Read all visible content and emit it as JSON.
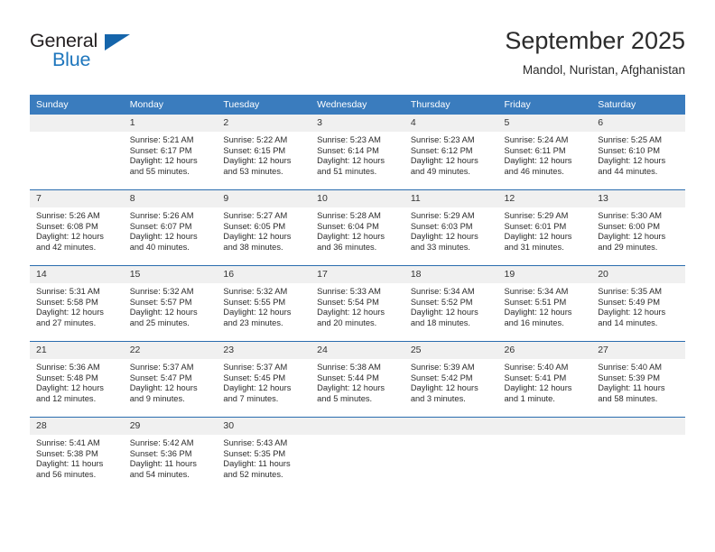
{
  "brand": {
    "name_part1": "General",
    "name_part2": "Blue",
    "accent_color": "#1565ab",
    "triangle_icon": "triangle-icon"
  },
  "header": {
    "title": "September 2025",
    "subtitle": "Mandol, Nuristan, Afghanistan"
  },
  "calendar": {
    "header_bg": "#3a7cbe",
    "daynum_bg": "#f0f0f0",
    "separator_color": "#2a6cae",
    "weekday_headers": [
      "Sunday",
      "Monday",
      "Tuesday",
      "Wednesday",
      "Thursday",
      "Friday",
      "Saturday"
    ],
    "weeks": [
      [
        {
          "day": "",
          "sunrise": "",
          "sunset": "",
          "daylight1": "",
          "daylight2": "",
          "blank": true
        },
        {
          "day": "1",
          "sunrise": "Sunrise: 5:21 AM",
          "sunset": "Sunset: 6:17 PM",
          "daylight1": "Daylight: 12 hours",
          "daylight2": "and 55 minutes."
        },
        {
          "day": "2",
          "sunrise": "Sunrise: 5:22 AM",
          "sunset": "Sunset: 6:15 PM",
          "daylight1": "Daylight: 12 hours",
          "daylight2": "and 53 minutes."
        },
        {
          "day": "3",
          "sunrise": "Sunrise: 5:23 AM",
          "sunset": "Sunset: 6:14 PM",
          "daylight1": "Daylight: 12 hours",
          "daylight2": "and 51 minutes."
        },
        {
          "day": "4",
          "sunrise": "Sunrise: 5:23 AM",
          "sunset": "Sunset: 6:12 PM",
          "daylight1": "Daylight: 12 hours",
          "daylight2": "and 49 minutes."
        },
        {
          "day": "5",
          "sunrise": "Sunrise: 5:24 AM",
          "sunset": "Sunset: 6:11 PM",
          "daylight1": "Daylight: 12 hours",
          "daylight2": "and 46 minutes."
        },
        {
          "day": "6",
          "sunrise": "Sunrise: 5:25 AM",
          "sunset": "Sunset: 6:10 PM",
          "daylight1": "Daylight: 12 hours",
          "daylight2": "and 44 minutes."
        }
      ],
      [
        {
          "day": "7",
          "sunrise": "Sunrise: 5:26 AM",
          "sunset": "Sunset: 6:08 PM",
          "daylight1": "Daylight: 12 hours",
          "daylight2": "and 42 minutes."
        },
        {
          "day": "8",
          "sunrise": "Sunrise: 5:26 AM",
          "sunset": "Sunset: 6:07 PM",
          "daylight1": "Daylight: 12 hours",
          "daylight2": "and 40 minutes."
        },
        {
          "day": "9",
          "sunrise": "Sunrise: 5:27 AM",
          "sunset": "Sunset: 6:05 PM",
          "daylight1": "Daylight: 12 hours",
          "daylight2": "and 38 minutes."
        },
        {
          "day": "10",
          "sunrise": "Sunrise: 5:28 AM",
          "sunset": "Sunset: 6:04 PM",
          "daylight1": "Daylight: 12 hours",
          "daylight2": "and 36 minutes."
        },
        {
          "day": "11",
          "sunrise": "Sunrise: 5:29 AM",
          "sunset": "Sunset: 6:03 PM",
          "daylight1": "Daylight: 12 hours",
          "daylight2": "and 33 minutes."
        },
        {
          "day": "12",
          "sunrise": "Sunrise: 5:29 AM",
          "sunset": "Sunset: 6:01 PM",
          "daylight1": "Daylight: 12 hours",
          "daylight2": "and 31 minutes."
        },
        {
          "day": "13",
          "sunrise": "Sunrise: 5:30 AM",
          "sunset": "Sunset: 6:00 PM",
          "daylight1": "Daylight: 12 hours",
          "daylight2": "and 29 minutes."
        }
      ],
      [
        {
          "day": "14",
          "sunrise": "Sunrise: 5:31 AM",
          "sunset": "Sunset: 5:58 PM",
          "daylight1": "Daylight: 12 hours",
          "daylight2": "and 27 minutes."
        },
        {
          "day": "15",
          "sunrise": "Sunrise: 5:32 AM",
          "sunset": "Sunset: 5:57 PM",
          "daylight1": "Daylight: 12 hours",
          "daylight2": "and 25 minutes."
        },
        {
          "day": "16",
          "sunrise": "Sunrise: 5:32 AM",
          "sunset": "Sunset: 5:55 PM",
          "daylight1": "Daylight: 12 hours",
          "daylight2": "and 23 minutes."
        },
        {
          "day": "17",
          "sunrise": "Sunrise: 5:33 AM",
          "sunset": "Sunset: 5:54 PM",
          "daylight1": "Daylight: 12 hours",
          "daylight2": "and 20 minutes."
        },
        {
          "day": "18",
          "sunrise": "Sunrise: 5:34 AM",
          "sunset": "Sunset: 5:52 PM",
          "daylight1": "Daylight: 12 hours",
          "daylight2": "and 18 minutes."
        },
        {
          "day": "19",
          "sunrise": "Sunrise: 5:34 AM",
          "sunset": "Sunset: 5:51 PM",
          "daylight1": "Daylight: 12 hours",
          "daylight2": "and 16 minutes."
        },
        {
          "day": "20",
          "sunrise": "Sunrise: 5:35 AM",
          "sunset": "Sunset: 5:49 PM",
          "daylight1": "Daylight: 12 hours",
          "daylight2": "and 14 minutes."
        }
      ],
      [
        {
          "day": "21",
          "sunrise": "Sunrise: 5:36 AM",
          "sunset": "Sunset: 5:48 PM",
          "daylight1": "Daylight: 12 hours",
          "daylight2": "and 12 minutes."
        },
        {
          "day": "22",
          "sunrise": "Sunrise: 5:37 AM",
          "sunset": "Sunset: 5:47 PM",
          "daylight1": "Daylight: 12 hours",
          "daylight2": "and 9 minutes."
        },
        {
          "day": "23",
          "sunrise": "Sunrise: 5:37 AM",
          "sunset": "Sunset: 5:45 PM",
          "daylight1": "Daylight: 12 hours",
          "daylight2": "and 7 minutes."
        },
        {
          "day": "24",
          "sunrise": "Sunrise: 5:38 AM",
          "sunset": "Sunset: 5:44 PM",
          "daylight1": "Daylight: 12 hours",
          "daylight2": "and 5 minutes."
        },
        {
          "day": "25",
          "sunrise": "Sunrise: 5:39 AM",
          "sunset": "Sunset: 5:42 PM",
          "daylight1": "Daylight: 12 hours",
          "daylight2": "and 3 minutes."
        },
        {
          "day": "26",
          "sunrise": "Sunrise: 5:40 AM",
          "sunset": "Sunset: 5:41 PM",
          "daylight1": "Daylight: 12 hours",
          "daylight2": "and 1 minute."
        },
        {
          "day": "27",
          "sunrise": "Sunrise: 5:40 AM",
          "sunset": "Sunset: 5:39 PM",
          "daylight1": "Daylight: 11 hours",
          "daylight2": "and 58 minutes."
        }
      ],
      [
        {
          "day": "28",
          "sunrise": "Sunrise: 5:41 AM",
          "sunset": "Sunset: 5:38 PM",
          "daylight1": "Daylight: 11 hours",
          "daylight2": "and 56 minutes."
        },
        {
          "day": "29",
          "sunrise": "Sunrise: 5:42 AM",
          "sunset": "Sunset: 5:36 PM",
          "daylight1": "Daylight: 11 hours",
          "daylight2": "and 54 minutes."
        },
        {
          "day": "30",
          "sunrise": "Sunrise: 5:43 AM",
          "sunset": "Sunset: 5:35 PM",
          "daylight1": "Daylight: 11 hours",
          "daylight2": "and 52 minutes."
        },
        {
          "day": "",
          "sunrise": "",
          "sunset": "",
          "daylight1": "",
          "daylight2": "",
          "blank": true
        },
        {
          "day": "",
          "sunrise": "",
          "sunset": "",
          "daylight1": "",
          "daylight2": "",
          "blank": true
        },
        {
          "day": "",
          "sunrise": "",
          "sunset": "",
          "daylight1": "",
          "daylight2": "",
          "blank": true
        },
        {
          "day": "",
          "sunrise": "",
          "sunset": "",
          "daylight1": "",
          "daylight2": "",
          "blank": true
        }
      ]
    ]
  }
}
